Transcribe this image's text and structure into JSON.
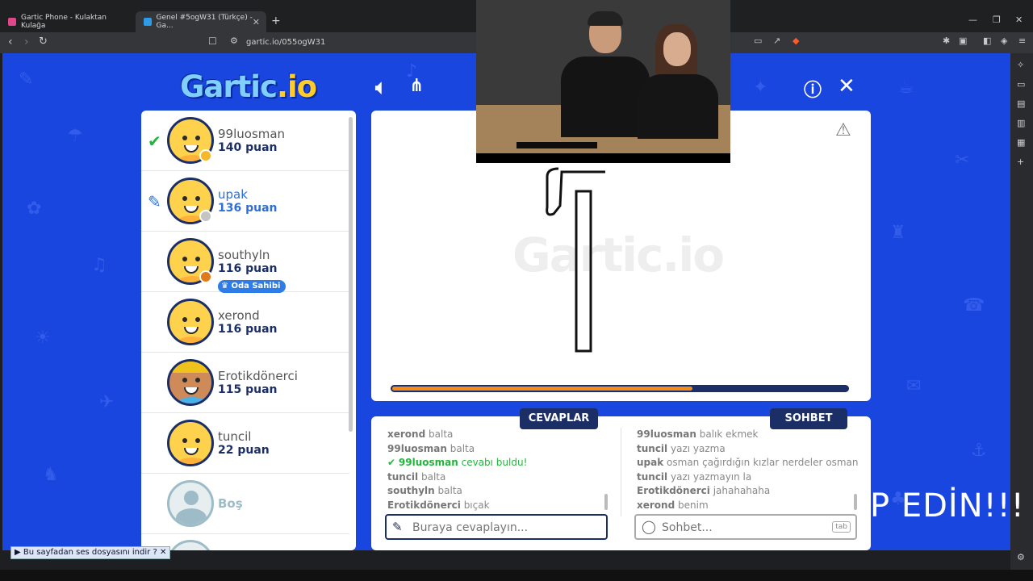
{
  "browser": {
    "tabs": [
      {
        "title": "Gartic Phone - Kulaktan Kulağa"
      },
      {
        "title": "Genel #5ogW31 (Türkçe) - Ga..."
      }
    ],
    "url": "gartic.io/055ogW31"
  },
  "game": {
    "logo_main": "Gartic",
    "logo_io": ".io",
    "players": [
      {
        "name": "99luosman",
        "score": "140 puan",
        "status": "guessed",
        "dot_color": "#f6b82a",
        "name_color": "#555"
      },
      {
        "name": "upak",
        "score": "136 puan",
        "status": "drawing",
        "dot_color": "#c4c4c4",
        "name_color": "#2d6fd6"
      },
      {
        "name": "southyln",
        "score": "116 puan",
        "status": "owner",
        "dot_color": "#e07b1b",
        "name_color": "#555",
        "badge": "Oda Sahibi"
      },
      {
        "name": "xerond",
        "score": "116 puan",
        "status": "",
        "name_color": "#555"
      },
      {
        "name": "Erotikdönerci",
        "score": "115 puan",
        "status": "",
        "name_color": "#555"
      },
      {
        "name": "tuncil",
        "score": "22 puan",
        "status": "",
        "name_color": "#555"
      },
      {
        "name": "Boş",
        "score": "",
        "status": "empty",
        "name_color": "#9dbcc8"
      }
    ],
    "canvas": {
      "watermark": "Gartic.io",
      "progress": 0.66
    },
    "answers": {
      "title": "CEVAPLAR",
      "messages": [
        {
          "user": "xerond",
          "text": "balta"
        },
        {
          "user": "99luosman",
          "text": "balta"
        },
        {
          "user": "99luosman",
          "text": "cevabı buldu!",
          "correct": true
        },
        {
          "user": "tuncil",
          "text": "balta"
        },
        {
          "user": "southyln",
          "text": "balta"
        },
        {
          "user": "Erotikdönerci",
          "text": "bıçak"
        }
      ],
      "placeholder": "Buraya cevaplayın..."
    },
    "chat": {
      "title": "SOHBET",
      "messages": [
        {
          "user": "99luosman",
          "text": "balık ekmek"
        },
        {
          "user": "tuncil",
          "text": "yazı yazma"
        },
        {
          "user": "upak",
          "text": "osman çağırdığın kızlar nerdeler osman"
        },
        {
          "user": "tuncil",
          "text": "yazı yazmayın la"
        },
        {
          "user": "Erotikdönerci",
          "text": "jahahahaha"
        },
        {
          "user": "xerond",
          "text": "benim"
        }
      ],
      "placeholder": "Sohbet...",
      "tab_key": "tab"
    }
  },
  "overlay_text": "P EDİN!!!",
  "download_bar": "Bu sayfadan ses dosyasını indir"
}
